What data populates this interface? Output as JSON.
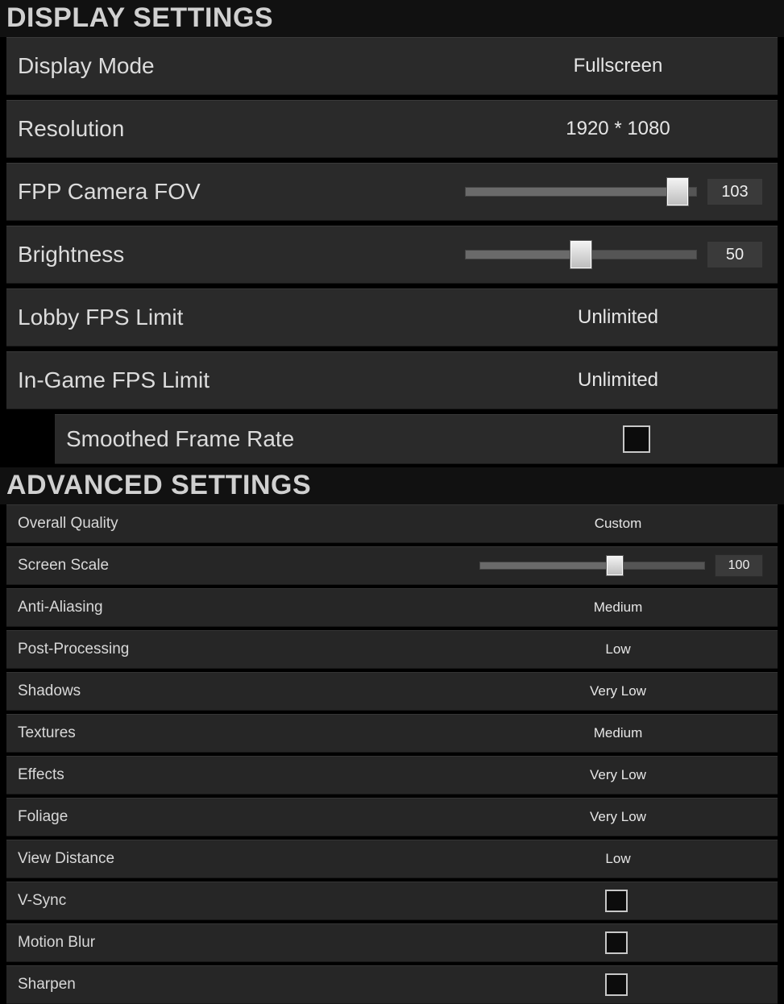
{
  "display": {
    "title": "DISPLAY SETTINGS",
    "display_mode": {
      "label": "Display Mode",
      "value": "Fullscreen"
    },
    "resolution": {
      "label": "Resolution",
      "value": "1920 * 1080"
    },
    "fov": {
      "label": "FPP Camera FOV",
      "value": "103",
      "percent": 92
    },
    "brightness": {
      "label": "Brightness",
      "value": "50",
      "percent": 50
    },
    "lobby_fps": {
      "label": "Lobby FPS Limit",
      "value": "Unlimited"
    },
    "ingame_fps": {
      "label": "In-Game FPS Limit",
      "value": "Unlimited"
    },
    "smoothed": {
      "label": "Smoothed Frame Rate"
    }
  },
  "advanced": {
    "title": "ADVANCED SETTINGS",
    "overall_quality": {
      "label": "Overall Quality",
      "value": "Custom"
    },
    "screen_scale": {
      "label": "Screen Scale",
      "value": "100",
      "percent": 60
    },
    "anti_aliasing": {
      "label": "Anti-Aliasing",
      "value": "Medium"
    },
    "post_processing": {
      "label": "Post-Processing",
      "value": "Low"
    },
    "shadows": {
      "label": "Shadows",
      "value": "Very Low"
    },
    "textures": {
      "label": "Textures",
      "value": "Medium"
    },
    "effects": {
      "label": "Effects",
      "value": "Very Low"
    },
    "foliage": {
      "label": "Foliage",
      "value": "Very Low"
    },
    "view_distance": {
      "label": "View Distance",
      "value": "Low"
    },
    "vsync": {
      "label": "V-Sync"
    },
    "motion_blur": {
      "label": "Motion Blur"
    },
    "sharpen": {
      "label": "Sharpen"
    }
  }
}
